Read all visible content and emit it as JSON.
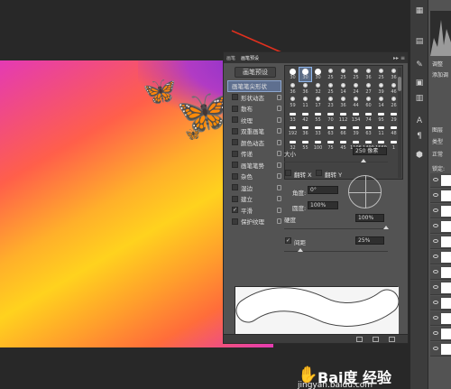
{
  "panel": {
    "tabs": [
      "画笔",
      "画笔预设"
    ],
    "presets_button": "画笔预设",
    "options": [
      {
        "label": "画笔笔尖形状",
        "checked": false,
        "locked": false,
        "selected": true,
        "has_checkbox": false
      },
      {
        "label": "形状动态",
        "checked": false,
        "locked": true
      },
      {
        "label": "散布",
        "checked": false,
        "locked": true
      },
      {
        "label": "纹理",
        "checked": false,
        "locked": true
      },
      {
        "label": "双重画笔",
        "checked": false,
        "locked": true
      },
      {
        "label": "颜色动态",
        "checked": false,
        "locked": true
      },
      {
        "label": "传递",
        "checked": false,
        "locked": true
      },
      {
        "label": "画笔笔势",
        "checked": false,
        "locked": true
      },
      {
        "label": "杂色",
        "checked": false,
        "locked": true
      },
      {
        "label": "湿边",
        "checked": false,
        "locked": true
      },
      {
        "label": "建立",
        "checked": false,
        "locked": true
      },
      {
        "label": "平滑",
        "checked": true,
        "locked": true
      },
      {
        "label": "保护纹理",
        "checked": false,
        "locked": true
      }
    ],
    "tips": [
      {
        "size": "30",
        "kind": "hard"
      },
      {
        "size": "30",
        "kind": "hard",
        "selected": true
      },
      {
        "size": "30",
        "kind": "hard"
      },
      {
        "size": "25",
        "kind": "soft"
      },
      {
        "size": "25",
        "kind": "soft"
      },
      {
        "size": "25",
        "kind": "soft"
      },
      {
        "size": "36",
        "kind": "soft"
      },
      {
        "size": "25",
        "kind": "soft"
      },
      {
        "size": "36",
        "kind": "soft"
      },
      {
        "size": "36",
        "kind": "soft"
      },
      {
        "size": "36",
        "kind": "soft"
      },
      {
        "size": "32",
        "kind": "soft"
      },
      {
        "size": "25",
        "kind": "soft"
      },
      {
        "size": "14",
        "kind": "soft"
      },
      {
        "size": "24",
        "kind": "soft"
      },
      {
        "size": "27",
        "kind": "soft"
      },
      {
        "size": "39",
        "kind": "soft"
      },
      {
        "size": "46",
        "kind": "soft"
      },
      {
        "size": "59",
        "kind": "soft"
      },
      {
        "size": "11",
        "kind": "soft"
      },
      {
        "size": "17",
        "kind": "soft"
      },
      {
        "size": "23",
        "kind": "soft"
      },
      {
        "size": "36",
        "kind": "soft"
      },
      {
        "size": "44",
        "kind": "soft"
      },
      {
        "size": "60",
        "kind": "soft"
      },
      {
        "size": "14",
        "kind": "soft"
      },
      {
        "size": "26",
        "kind": "soft"
      },
      {
        "size": "33",
        "kind": "dash"
      },
      {
        "size": "42",
        "kind": "dash"
      },
      {
        "size": "55",
        "kind": "dash"
      },
      {
        "size": "70",
        "kind": "dash"
      },
      {
        "size": "112",
        "kind": "dash"
      },
      {
        "size": "134",
        "kind": "dash"
      },
      {
        "size": "74",
        "kind": "dash"
      },
      {
        "size": "95",
        "kind": "dash"
      },
      {
        "size": "29",
        "kind": "dash"
      },
      {
        "size": "192",
        "kind": "dash"
      },
      {
        "size": "36",
        "kind": "dash"
      },
      {
        "size": "33",
        "kind": "dash"
      },
      {
        "size": "63",
        "kind": "dash"
      },
      {
        "size": "66",
        "kind": "dash"
      },
      {
        "size": "39",
        "kind": "dash"
      },
      {
        "size": "63",
        "kind": "dash"
      },
      {
        "size": "11",
        "kind": "dash"
      },
      {
        "size": "48",
        "kind": "dash"
      },
      {
        "size": "32",
        "kind": "dash"
      },
      {
        "size": "55",
        "kind": "dash"
      },
      {
        "size": "100",
        "kind": "dash"
      },
      {
        "size": "75",
        "kind": "dash"
      },
      {
        "size": "45",
        "kind": "dash"
      },
      {
        "size": "1106",
        "kind": "dash"
      },
      {
        "size": "1499",
        "kind": "dash"
      },
      {
        "size": "1569",
        "kind": "dash"
      },
      {
        "size": "1",
        "kind": "dash"
      }
    ],
    "size_label": "大小",
    "size_value": "250 像素",
    "flip_x": "翻转 X",
    "flip_y": "翻转 Y",
    "angle_label": "角度:",
    "angle_value": "0°",
    "roundness_label": "圆度:",
    "roundness_value": "100%",
    "hardness_label": "硬度",
    "hardness_value": "100%",
    "spacing_label": "间距",
    "spacing_checked": true,
    "spacing_value": "25%"
  },
  "right_panel": {
    "labels": [
      "调整",
      "添加调",
      "图层",
      "类型",
      "正常",
      "锁定:"
    ]
  },
  "watermark": {
    "brand": "Bai度 经验",
    "url": "jingyan.baidu.com"
  },
  "colors": {
    "panel_bg": "#535353",
    "workspace_bg": "#282828",
    "arrow": "#e0301e",
    "selection": "#5e6f8f"
  }
}
